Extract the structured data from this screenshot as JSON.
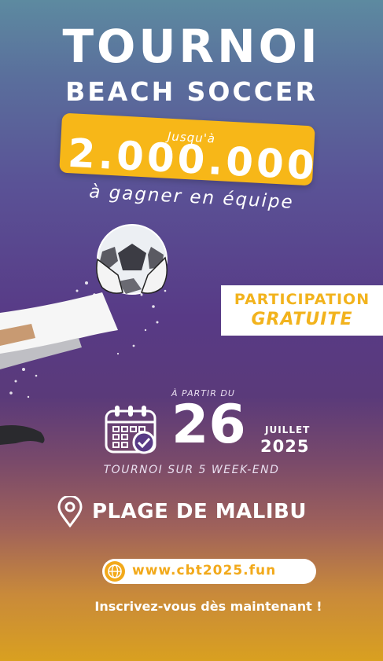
{
  "header": {
    "title": "TOURNOI",
    "subtitle": "BEACH SOCCER"
  },
  "prize": {
    "up_to": "Jusqu'à",
    "amount": "2.000.000",
    "team_text": "à gagner en équipe",
    "box_color": "#f7b718"
  },
  "participation": {
    "line1": "PARTICIPATION",
    "line2": "GRATUITE",
    "text_color": "#f2b31d"
  },
  "date": {
    "from_label": "À PARTIR DU",
    "day": "26",
    "month": "JUILLET",
    "year": "2025",
    "duration": "TOURNOI SUR 5 WEEK-END",
    "icon": "calendar-check-icon"
  },
  "location": {
    "icon": "map-pin-icon",
    "name": "PLAGE DE MALIBU"
  },
  "website": {
    "icon": "globe-icon",
    "url": "www.cbt2025.fun",
    "accent": "#f2a91a"
  },
  "cta": {
    "text": "Inscrivez-vous dès maintenant !"
  }
}
